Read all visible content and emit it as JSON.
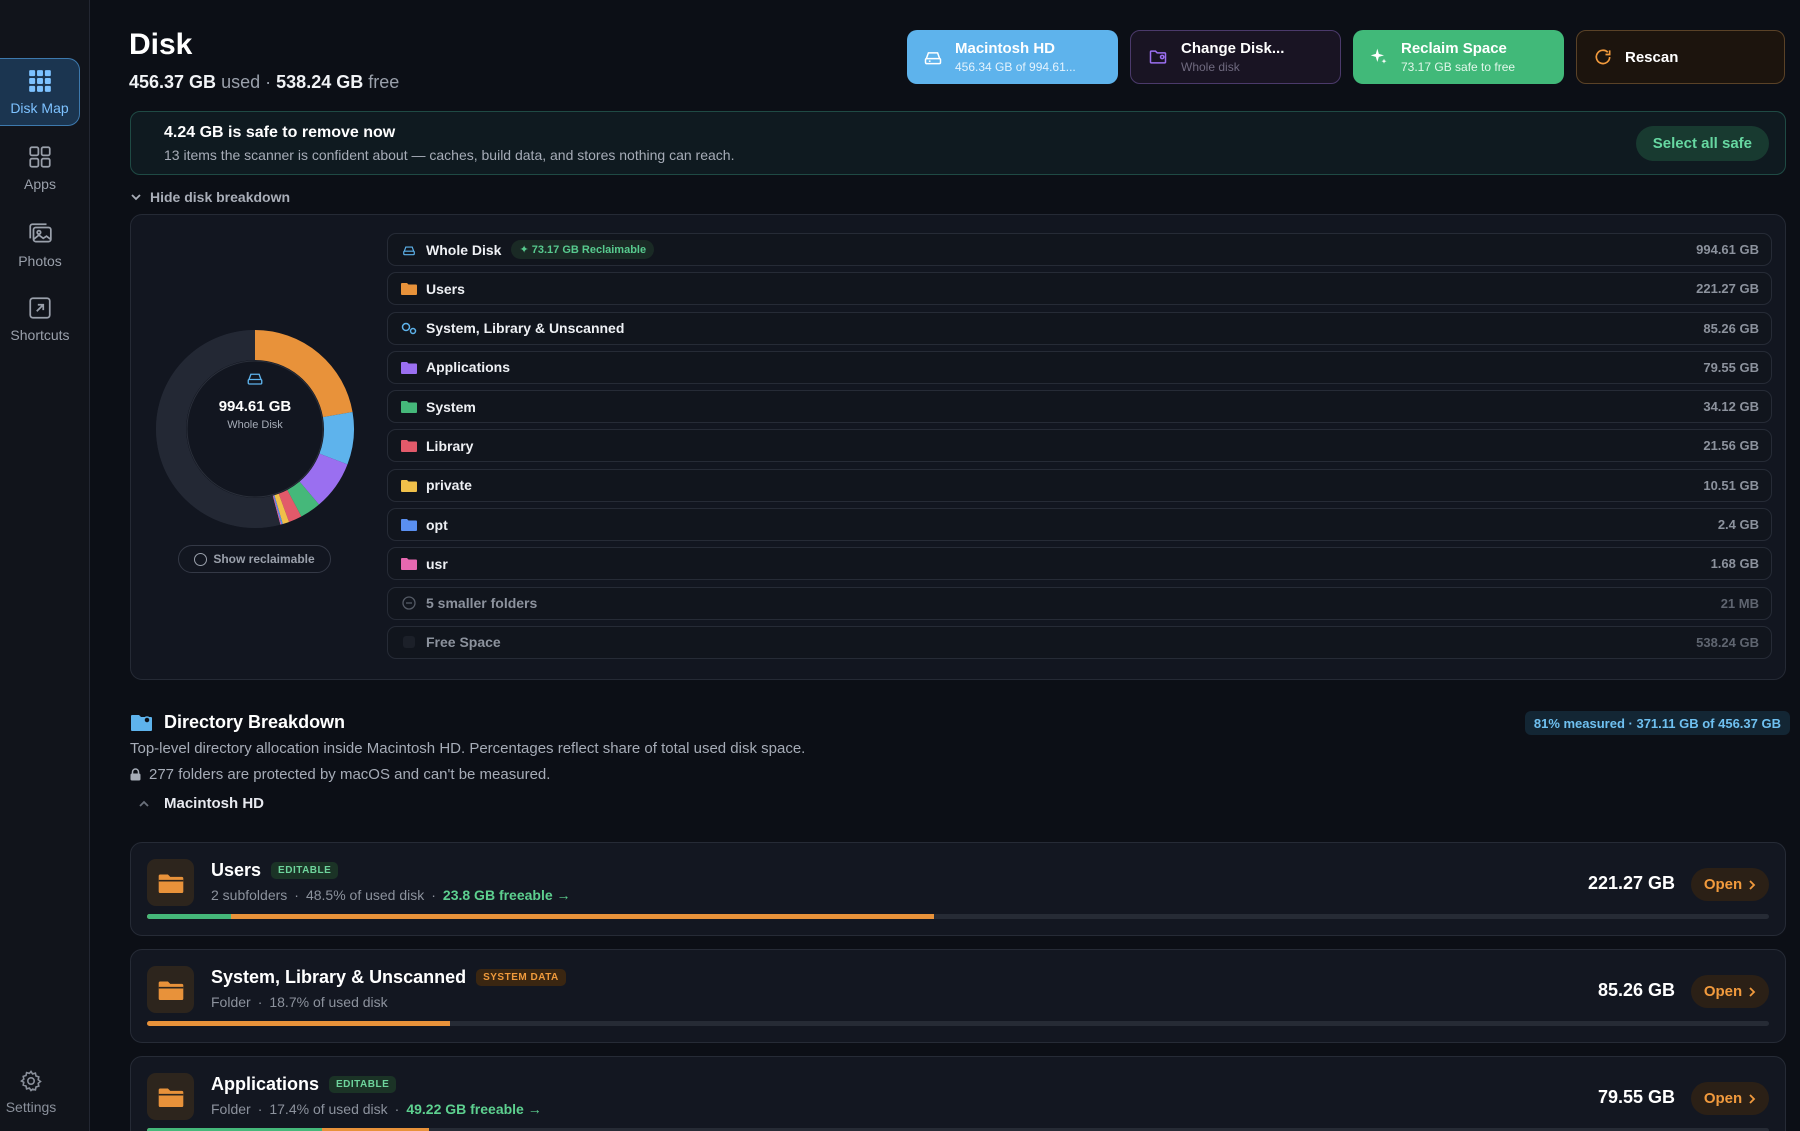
{
  "sidebar": {
    "items": [
      {
        "label": "Disk Map",
        "icon": "grid-icon"
      },
      {
        "label": "Apps",
        "icon": "apps-icon"
      },
      {
        "label": "Photos",
        "icon": "photos-icon"
      },
      {
        "label": "Shortcuts",
        "icon": "shortcuts-icon"
      }
    ],
    "settings_label": "Settings"
  },
  "header": {
    "title": "Disk",
    "used_value": "456.37 GB",
    "used_label": "used",
    "sep": "·",
    "free_value": "538.24 GB",
    "free_label": "free"
  },
  "top_buttons": {
    "disk": {
      "title": "Macintosh HD",
      "sub": "456.34 GB of 994.61..."
    },
    "change": {
      "title": "Change Disk...",
      "sub": "Whole disk"
    },
    "reclaim": {
      "title": "Reclaim Space",
      "sub": "73.17 GB safe to free"
    },
    "rescan": {
      "title": "Rescan"
    }
  },
  "banner": {
    "headline": "4.24 GB is safe to remove now",
    "sub": "13 items the scanner is confident about — caches, build data, and stores nothing can reach.",
    "button": "Select all safe"
  },
  "breakdown": {
    "toggle_label": "Hide disk breakdown",
    "center_value": "994.61 GB",
    "center_label": "Whole Disk",
    "show_reclaimable": "Show reclaimable",
    "reclaimable_pill": "73.17 GB Reclaimable",
    "rows": [
      {
        "name": "Whole Disk",
        "size": "994.61 GB",
        "gb": 994.61,
        "color": "#5eb3ec"
      },
      {
        "name": "Users",
        "size": "221.27 GB",
        "gb": 221.27,
        "color": "#e8923a"
      },
      {
        "name": "System, Library & Unscanned",
        "size": "85.26 GB",
        "gb": 85.26,
        "color": "#5eb3ec"
      },
      {
        "name": "Applications",
        "size": "79.55 GB",
        "gb": 79.55,
        "color": "#9a6ff0"
      },
      {
        "name": "System",
        "size": "34.12 GB",
        "gb": 34.12,
        "color": "#45b87a"
      },
      {
        "name": "Library",
        "size": "21.56 GB",
        "gb": 21.56,
        "color": "#e25a6a"
      },
      {
        "name": "private",
        "size": "10.51 GB",
        "gb": 10.51,
        "color": "#f0c04a"
      },
      {
        "name": "opt",
        "size": "2.4 GB",
        "gb": 2.4,
        "color": "#5a8ff0"
      },
      {
        "name": "usr",
        "size": "1.68 GB",
        "gb": 1.68,
        "color": "#e668b0"
      },
      {
        "name": "5 smaller folders",
        "size": "21 MB",
        "gb": 0.021,
        "color": "#555b66"
      },
      {
        "name": "Free Space",
        "size": "538.24 GB",
        "gb": 538.24,
        "color": "#2a2f3a"
      }
    ]
  },
  "directory": {
    "title": "Directory Breakdown",
    "measured": "81% measured · 371.11 GB of 456.37 GB",
    "desc": "Top-level directory allocation inside Macintosh HD. Percentages reflect share of total used disk space.",
    "protected": "277 folders are protected by macOS and can't be measured.",
    "crumb": "Macintosh HD",
    "open_label": "Open",
    "cards": [
      {
        "name": "Users",
        "tag": "EDITABLE",
        "kind": "2 subfolders",
        "pct": "48.5% of used disk",
        "freeable": "23.8 GB freeable →",
        "size": "221.27 GB",
        "share": 0.485,
        "freeable_share": 0.052
      },
      {
        "name": "System, Library & Unscanned",
        "tag": "SYSTEM DATA",
        "kind": "Folder",
        "pct": "18.7% of used disk",
        "freeable": "",
        "size": "85.26 GB",
        "share": 0.187,
        "freeable_share": 0
      },
      {
        "name": "Applications",
        "tag": "EDITABLE",
        "kind": "Folder",
        "pct": "17.4% of used disk",
        "freeable": "49.22 GB freeable →",
        "size": "79.55 GB",
        "share": 0.174,
        "freeable_share": 0.108
      }
    ]
  },
  "colors": {
    "accent_blue": "#5eb3ec",
    "accent_green": "#41b979",
    "accent_orange": "#e8923a"
  }
}
